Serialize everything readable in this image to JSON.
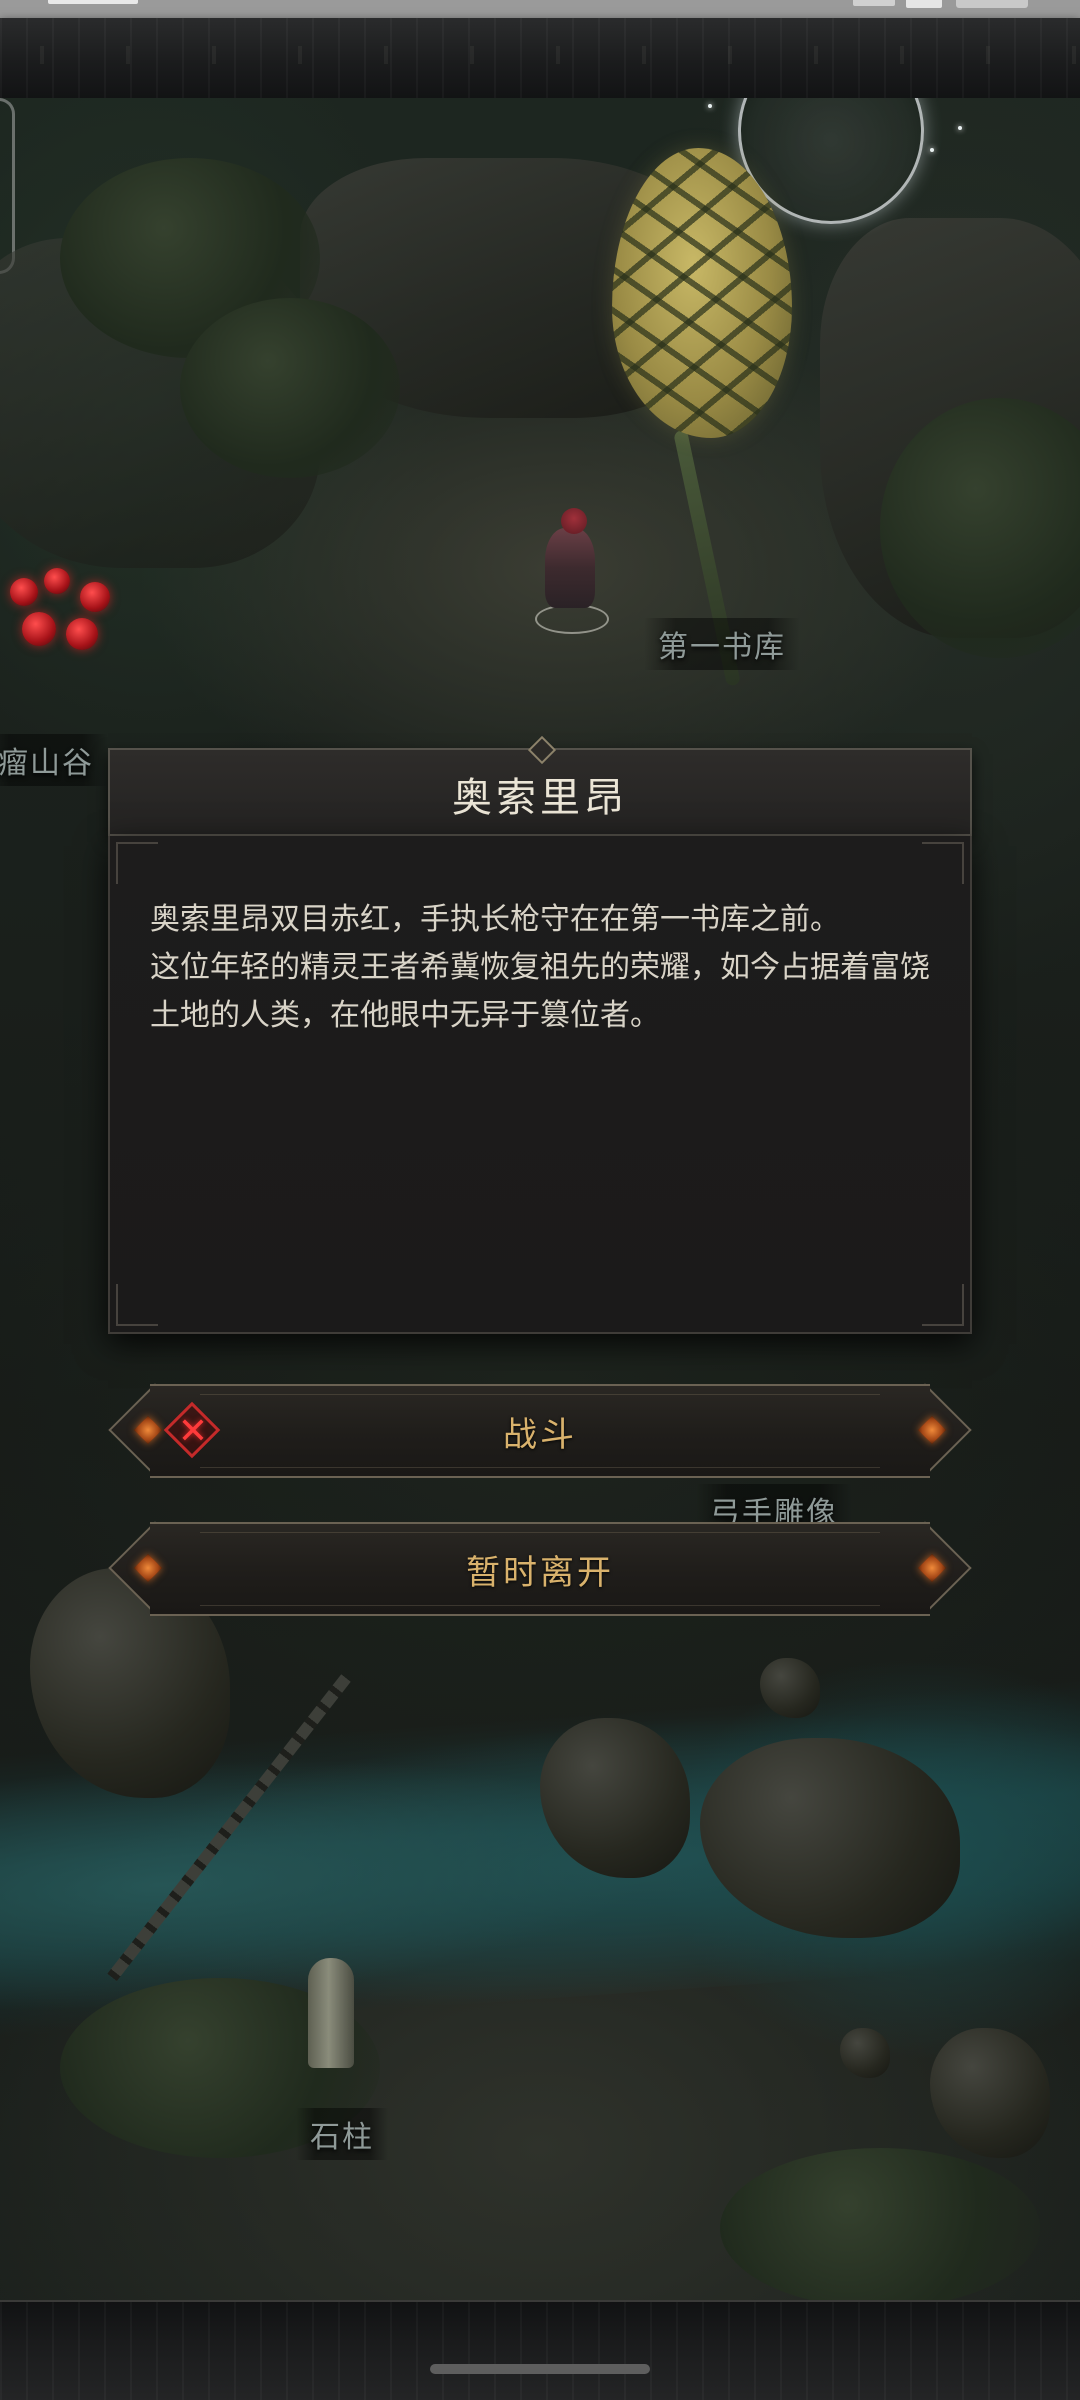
{
  "dialog": {
    "title": "奥索里昂",
    "description_lines": [
      "奥索里昂双目赤红，手执长枪守在在第一书库之前。",
      "这位年轻的精灵王者希冀恢复祖先的荣耀，如今占据着富饶土地的人类，在他眼中无异于篡位者。"
    ]
  },
  "actions": {
    "fight_label": "战斗",
    "leave_label": "暂时离开"
  },
  "map_labels": {
    "library": "第一书库",
    "valley": "瘤山谷",
    "archer_statue": "弓手雕像",
    "stone_pillar": "石柱"
  },
  "icons": {
    "fight": "crossed-swords-icon",
    "button_left_gem": "orange-diamond-icon",
    "button_right_gem": "orange-diamond-icon"
  },
  "colors": {
    "button_text": "#d9b26c",
    "title_text": "#ebe5d6",
    "body_text": "#d9d4c8",
    "map_label_text": "#8f9a98",
    "fight_icon": "#ff3b3b"
  }
}
